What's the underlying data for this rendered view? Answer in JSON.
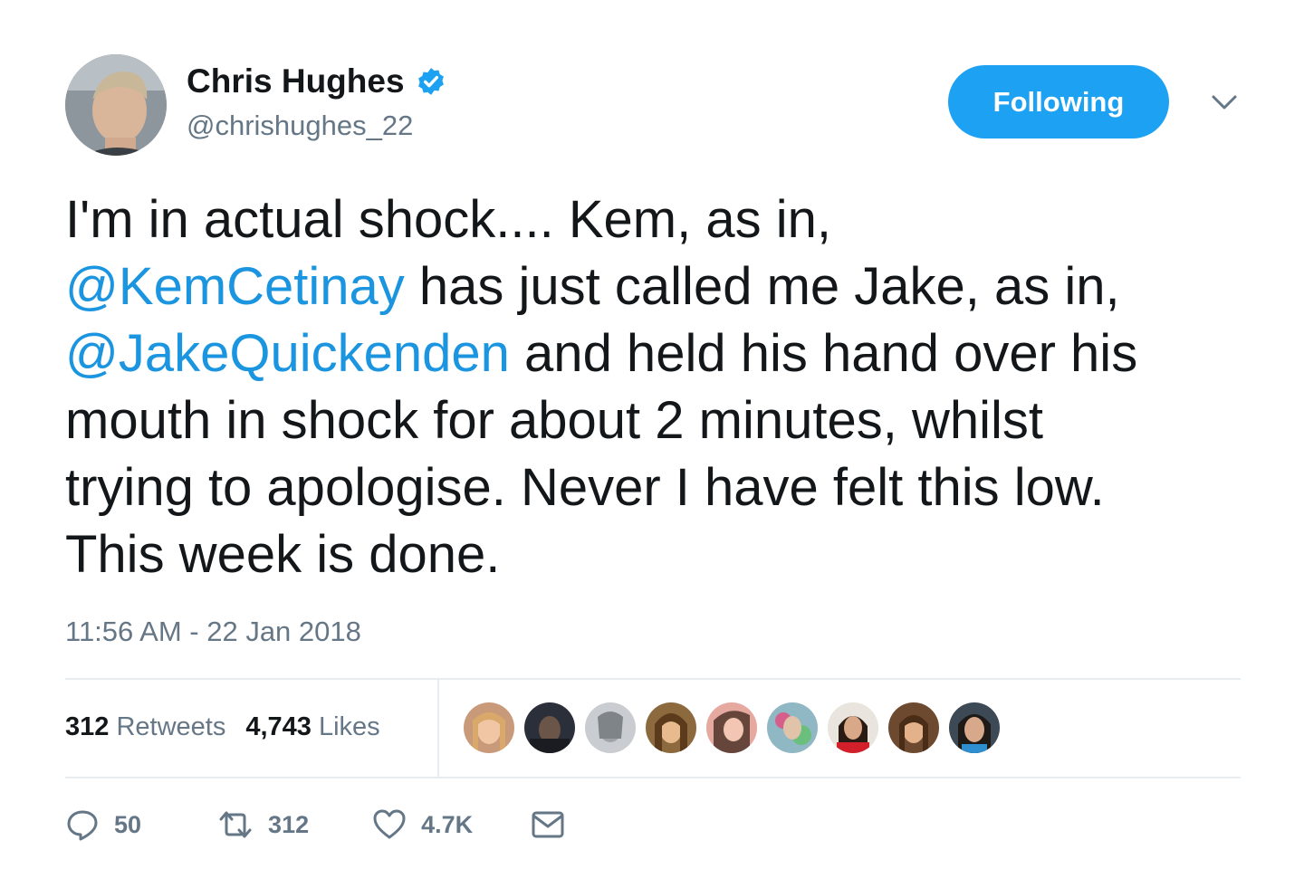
{
  "tweet": {
    "author": {
      "display_name": "Chris Hughes",
      "handle": "@chrishughes_22",
      "verified": true,
      "verified_icon": "verified-badge-icon"
    },
    "follow_button_label": "Following",
    "menu_icon": "chevron-down-icon",
    "text_lines": [
      [
        {
          "text": "I'm in actual shock.... Kem, as in,",
          "mention": false
        }
      ],
      [
        {
          "text": "@KemCetinay",
          "mention": true
        },
        {
          "text": " has just called me Jake, as in,",
          "mention": false
        }
      ],
      [
        {
          "text": "@JakeQuickenden",
          "mention": true
        },
        {
          "text": " and held his hand over his",
          "mention": false
        }
      ],
      [
        {
          "text": "mouth in shock for about 2 minutes, whilst",
          "mention": false
        }
      ],
      [
        {
          "text": "trying to apologise. Never I have felt this low.",
          "mention": false
        }
      ],
      [
        {
          "text": "This week is done.",
          "mention": false
        }
      ]
    ],
    "timestamp": "11:56 AM - 22 Jan 2018",
    "stats": {
      "retweets_count": "312",
      "retweets_label": "Retweets",
      "likes_count": "4,743",
      "likes_label": "Likes"
    },
    "liker_avatars_count": 9,
    "actions": {
      "reply_count": "50",
      "retweet_count": "312",
      "like_count": "4.7K"
    },
    "colors": {
      "accent": "#1da1f2",
      "mention": "#1b95e0",
      "text": "#14171a",
      "secondary_text": "#657786",
      "divider": "#e6ecf0"
    }
  }
}
